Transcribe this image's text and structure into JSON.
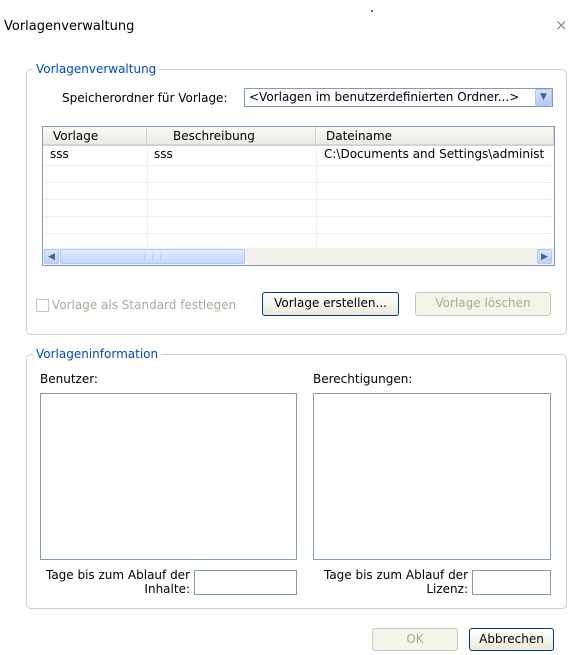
{
  "window": {
    "title": "Vorlagenverwaltung",
    "close_glyph": "×"
  },
  "templates_group": {
    "legend": "Vorlagenverwaltung",
    "folder_label": "Speicherordner für Vorlage:",
    "folder_value": "<Vorlagen im benutzerdefinierten Ordner...>",
    "table": {
      "columns": [
        "Vorlage",
        "Beschreibung",
        "Dateiname"
      ],
      "rows": [
        [
          "sss",
          "sss",
          "C:\\Documents and Settings\\administ"
        ]
      ]
    },
    "set_default_label": "Vorlage als Standard festlegen",
    "create_button": "Vorlage erstellen...",
    "delete_button": "Vorlage löschen"
  },
  "info_group": {
    "legend": "Vorlageninformation",
    "users_label": "Benutzer:",
    "permissions_label": "Berechtigungen:",
    "days_content_label_line1": "Tage bis zum Ablauf der",
    "days_content_label_line2": "Inhalte:",
    "days_license_label_line1": "Tage bis zum Ablauf der",
    "days_license_label_line2": "Lizenz:"
  },
  "footer": {
    "ok_button": "OK",
    "cancel_button": "Abbrechen"
  }
}
